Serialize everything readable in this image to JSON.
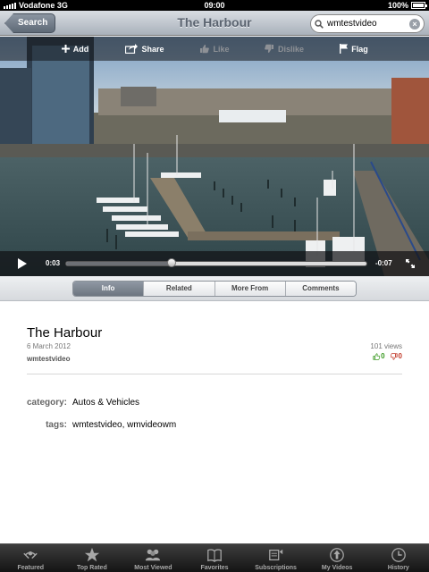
{
  "status_bar": {
    "carrier": "Vodafone 3G",
    "time": "09:00",
    "battery": "100%"
  },
  "nav": {
    "back_label": "Search",
    "title": "The Harbour",
    "search_value": "wmtestvideo"
  },
  "video_toolbar": {
    "add": "Add",
    "share": "Share",
    "like": "Like",
    "dislike": "Dislike",
    "flag": "Flag"
  },
  "player": {
    "elapsed": "0:03",
    "remaining": "-0:07",
    "progress": 0.35
  },
  "segments": [
    {
      "label": "Info",
      "active": true
    },
    {
      "label": "Related",
      "active": false
    },
    {
      "label": "More From",
      "active": false
    },
    {
      "label": "Comments",
      "active": false
    }
  ],
  "info": {
    "title": "The Harbour",
    "date": "6 March 2012",
    "author": "wmtestvideo",
    "views": "101 views",
    "likes": "0",
    "dislikes": "0",
    "category_label": "category:",
    "category_value": "Autos & Vehicles",
    "tags_label": "tags:",
    "tags_value": "wmtestvideo, wmvideowm"
  },
  "tabs": [
    {
      "label": "Featured",
      "icon": "featured-icon"
    },
    {
      "label": "Top Rated",
      "icon": "star-icon"
    },
    {
      "label": "Most Viewed",
      "icon": "people-icon"
    },
    {
      "label": "Favorites",
      "icon": "book-icon"
    },
    {
      "label": "Subscriptions",
      "icon": "subscriptions-icon"
    },
    {
      "label": "My Videos",
      "icon": "my-videos-icon"
    },
    {
      "label": "History",
      "icon": "clock-icon"
    }
  ]
}
